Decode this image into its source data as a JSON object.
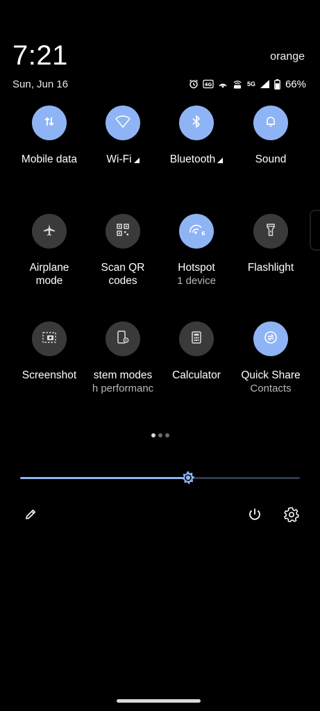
{
  "status": {
    "time": "7:21",
    "date": "Sun, Jun 16",
    "carrier": "orange",
    "network_label": "5G",
    "battery_pct": "66%",
    "icons": [
      "alarm-icon",
      "hd-voice-icon",
      "hotspot-status-icon",
      "wifi-calling-icon",
      "5g-icon",
      "signal-icon",
      "battery-icon"
    ]
  },
  "tiles": [
    {
      "label": "Mobile data",
      "icon": "mobile-data-icon",
      "on": true
    },
    {
      "label": "Wi-Fi",
      "icon": "wifi-icon",
      "on": true
    },
    {
      "label": "Bluetooth",
      "icon": "bluetooth-icon",
      "on": true
    },
    {
      "label": "Sound",
      "icon": "bell-icon",
      "on": true
    },
    {
      "label_line1": "Airplane",
      "label_line2": "mode",
      "icon": "airplane-icon",
      "on": false
    },
    {
      "label_line1": "Scan QR",
      "label_line2": "codes",
      "icon": "qr-code-icon",
      "on": false
    },
    {
      "label": "Hotspot",
      "sub": "1 device",
      "icon_badge": "6",
      "icon": "hotspot-icon",
      "on": true
    },
    {
      "label": "Flashlight",
      "icon": "flashlight-icon",
      "on": false
    },
    {
      "label": "Screenshot",
      "icon": "screenshot-icon",
      "on": false
    },
    {
      "label": "stem modes",
      "sub": "h performanc",
      "icon": "system-modes-icon",
      "on": false
    },
    {
      "label": "Calculator",
      "icon": "calculator-icon",
      "on": false
    },
    {
      "label": "Quick Share",
      "sub": "Contacts",
      "icon": "quick-share-icon",
      "on": true
    }
  ],
  "pager": {
    "pages": 3,
    "current": 1
  },
  "brightness": {
    "level": 0.6
  },
  "colors": {
    "accent": "#8fb4f5",
    "tile_off": "#3a3a3a",
    "background": "#000000"
  },
  "bottom": {
    "edit_icon": "pencil-icon",
    "power_icon": "power-icon",
    "settings_icon": "gear-icon"
  }
}
